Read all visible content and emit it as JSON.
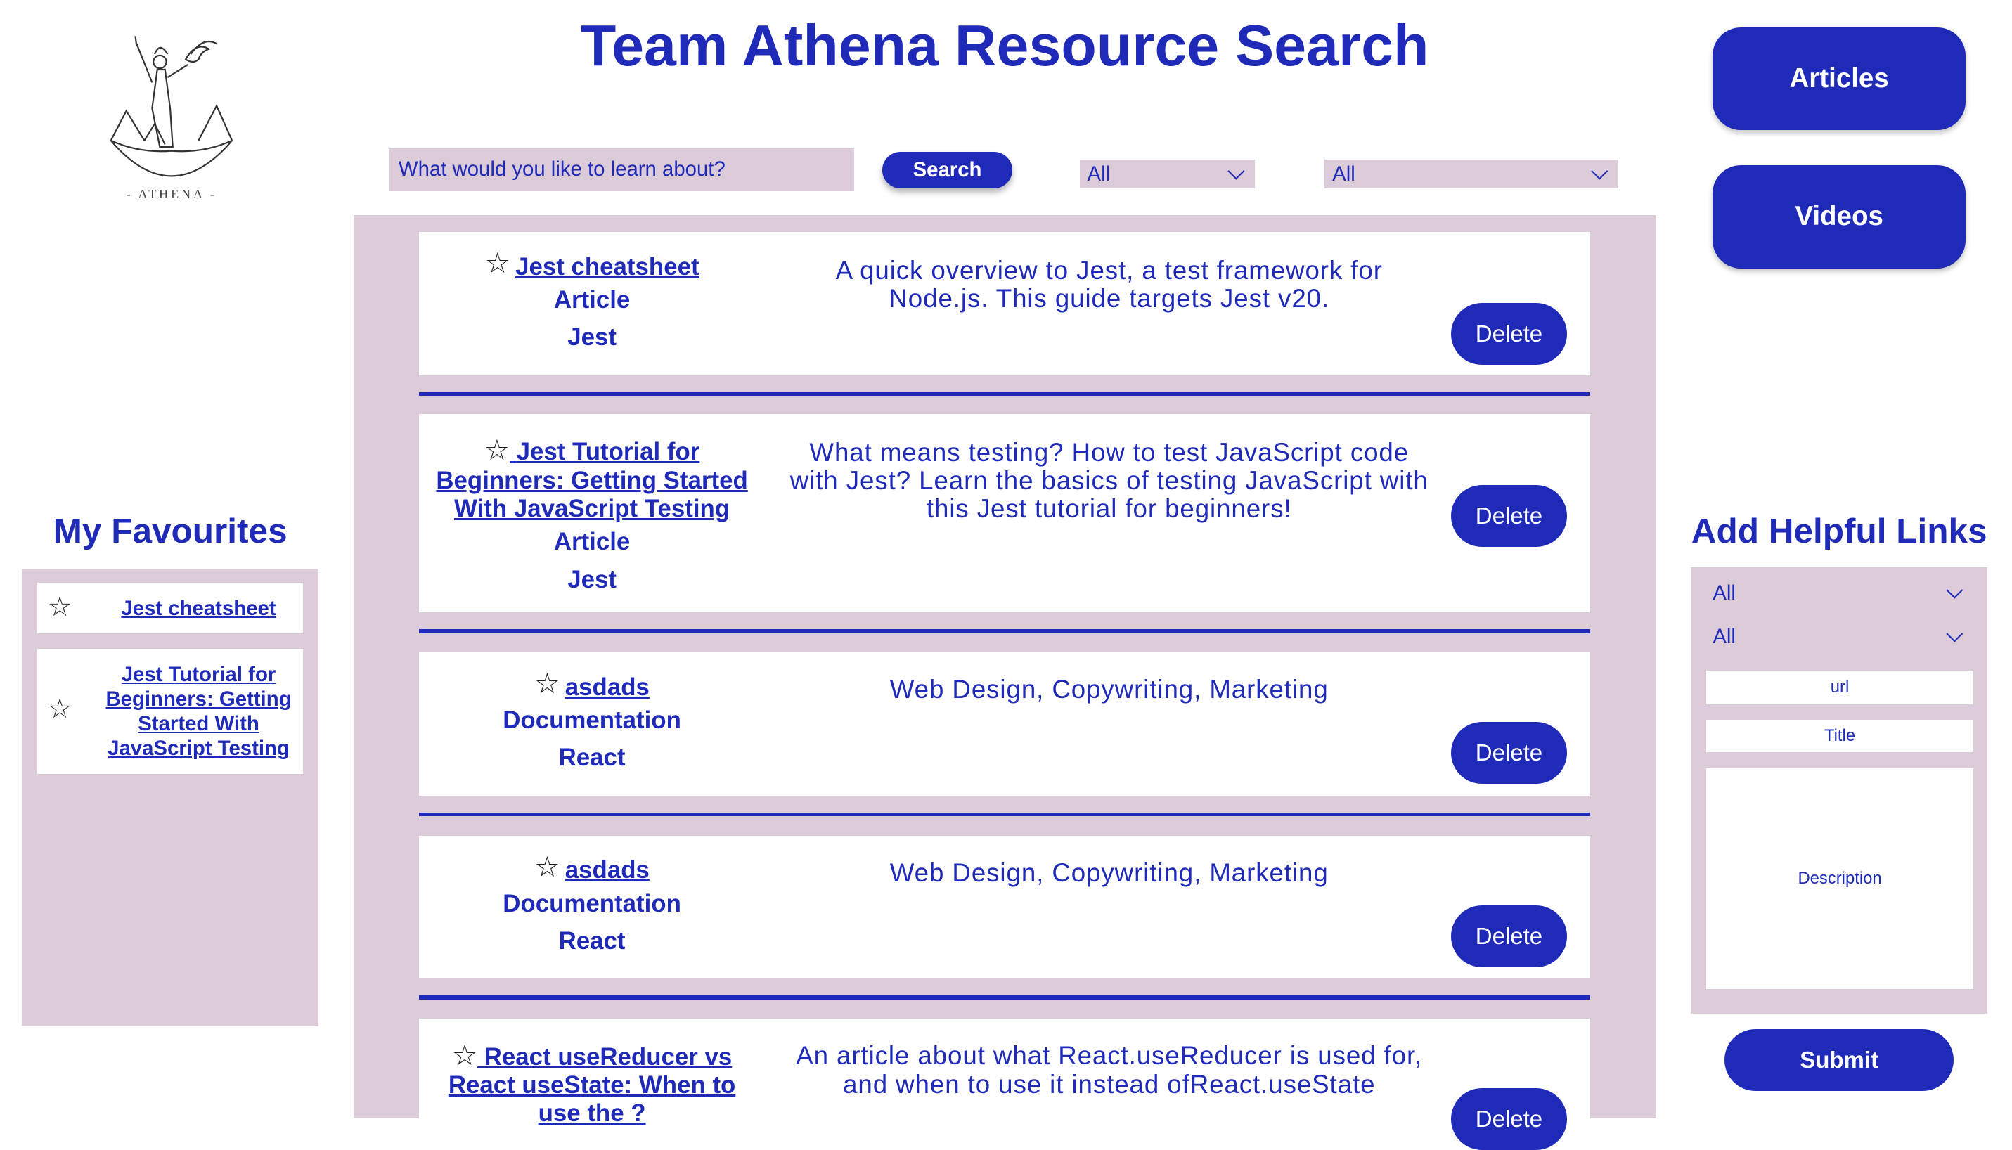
{
  "logo": {
    "text": "- ATHENA -"
  },
  "header": {
    "title": "Team Athena Resource Search"
  },
  "nav": {
    "articles_label": "Articles",
    "videos_label": "Videos"
  },
  "search": {
    "placeholder": "What would you like to learn about?",
    "button_label": "Search",
    "filter_type": "All",
    "filter_topic": "All"
  },
  "resources": [
    {
      "title": "Jest cheatsheet",
      "type": "Article",
      "topic": "Jest",
      "description": "A quick overview to Jest, a test framework for Node.js. This guide targets Jest v20.",
      "delete_label": "Delete"
    },
    {
      "title": "Jest Tutorial for Beginners: Getting Started With JavaScript Testing",
      "type": "Article",
      "topic": "Jest",
      "description": "What means testing? How to test JavaScript code with Jest? Learn the basics of testing JavaScript with this Jest tutorial for beginners!",
      "delete_label": "Delete"
    },
    {
      "title": "asdads",
      "type": "Documentation",
      "topic": "React",
      "description": "Web Design, Copywriting, Marketing",
      "delete_label": "Delete"
    },
    {
      "title": "asdads",
      "type": "Documentation",
      "topic": "React",
      "description": "Web Design, Copywriting, Marketing",
      "delete_label": "Delete"
    },
    {
      "title": "React useReducer vs React useState: When to use the ?",
      "type": "",
      "topic": "",
      "description": "An article about what React.useReducer is used for, and when to use it instead ofReact.useState",
      "delete_label": "Delete"
    }
  ],
  "favourites": {
    "heading": "My Favourites",
    "items": [
      {
        "label": "Jest cheatsheet"
      },
      {
        "label": "Jest Tutorial for Beginners: Getting Started With JavaScript Testing"
      }
    ]
  },
  "add_links": {
    "heading": "Add Helpful Links",
    "type_select": "All",
    "topic_select": "All",
    "url_placeholder": "url",
    "title_placeholder": "Title",
    "description_placeholder": "Description",
    "submit_label": "Submit"
  },
  "colors": {
    "primary": "#1f2bb8",
    "panel": "#dccbd8",
    "background": "#ffffff"
  },
  "icons": {
    "favourite": "star-icon",
    "dropdown": "chevron-down-icon"
  }
}
